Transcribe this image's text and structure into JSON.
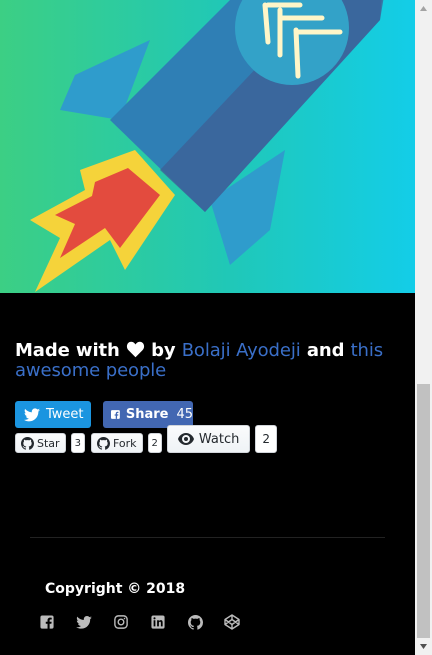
{
  "footer": {
    "made_with": "Made with",
    "by": "by",
    "author_link": "Bolaji Ayodeji",
    "and": "and",
    "people_link": "this awesome people"
  },
  "share": {
    "tweet_label": "Tweet",
    "share_label": "Share",
    "share_count": "45"
  },
  "github": {
    "star_label": "Star",
    "star_count": "3",
    "fork_label": "Fork",
    "fork_count": "2",
    "watch_label": "Watch",
    "watch_count": "2"
  },
  "copyright": "Copyright © 2018",
  "social_icons": [
    "facebook-icon",
    "twitter-icon",
    "instagram-icon",
    "linkedin-icon",
    "github-icon",
    "codepen-icon"
  ],
  "colors": {
    "link": "#3a6fc8",
    "tweet": "#1b95e0",
    "facebook": "#4267b2",
    "hero_left": "#3ccf84",
    "hero_right": "#13cde8"
  }
}
